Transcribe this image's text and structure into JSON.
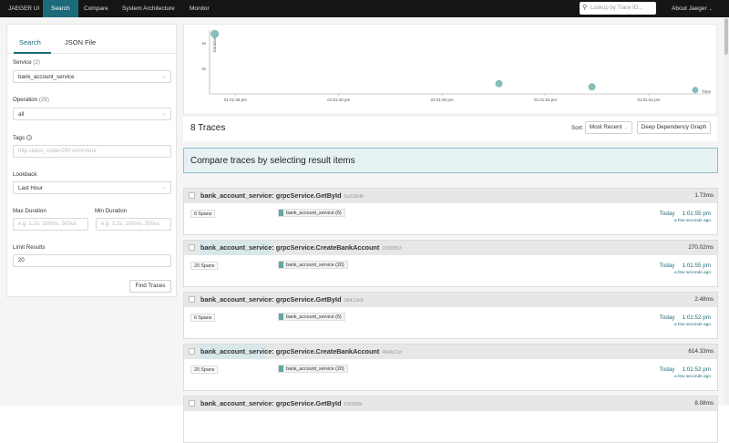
{
  "nav": {
    "brand": "JAEGER UI",
    "items": [
      "Search",
      "Compare",
      "System Architecture",
      "Monitor"
    ],
    "lookup_placeholder": "Lookup by Trace ID...",
    "about": "About Jaeger"
  },
  "sidebar": {
    "tabs": [
      "Search",
      "JSON File"
    ],
    "service_label": "Service",
    "service_count": "(2)",
    "service_value": "bank_account_service",
    "operation_label": "Operation",
    "operation_count": "(26)",
    "operation_value": "all",
    "tags_label": "Tags",
    "tags_placeholder": "http.status_code=200 error=true",
    "lookback_label": "Lookback",
    "lookback_value": "Last Hour",
    "max_duration_label": "Max Duration",
    "max_duration_placeholder": "e.g. 1.2s, 100ms, 500us",
    "min_duration_label": "Min Duration",
    "min_duration_placeholder": "e.g. 1.2s, 100ms, 500us",
    "limit_label": "Limit Results",
    "limit_value": "20",
    "find_button": "Find Traces"
  },
  "chart_data": {
    "type": "scatter",
    "ylabel": "Duration",
    "y_ticks": [
      "4s",
      "2s"
    ],
    "x_ticks": [
      "01:01:46 pm",
      "01:01:48 pm",
      "01:01:50 pm",
      "01:01:52 pm",
      "01:01:54 pm"
    ],
    "x_tail_label": "Time",
    "xlim": [
      45.5,
      55.2
    ],
    "ylim": [
      0,
      5
    ],
    "points": [
      {
        "x": 45.6,
        "y": 4.7,
        "r": 4.5
      },
      {
        "x": 51.1,
        "y": 0.8,
        "r": 4
      },
      {
        "x": 52.9,
        "y": 0.55,
        "r": 4
      },
      {
        "x": 54.9,
        "y": 0.3,
        "r": 3.5
      }
    ]
  },
  "results": {
    "count_text": "8 Traces",
    "sort_label": "Sort:",
    "sort_value": "Most Recent",
    "ddg_button": "Deep Dependency Graph",
    "compare_text": "Compare traces by selecting result items"
  },
  "traces": [
    {
      "service": "bank_account_service:",
      "op": "grpcService.GetById",
      "id": "6a338db",
      "duration": "1.73ms",
      "spans": "6 Spans",
      "svc_tag": "bank_account_service (6)",
      "day": "Today",
      "time": "1:01:55 pm",
      "ago": "a few seconds ago"
    },
    {
      "service": "bank_account_service:",
      "op": "grpcService.CreateBankAccount",
      "id": "2208853",
      "duration": "270.02ms",
      "spans": "20 Spans",
      "svc_tag": "bank_account_service (20)",
      "day": "Today",
      "time": "1:01:55 pm",
      "ago": "a few seconds ago"
    },
    {
      "service": "bank_account_service:",
      "op": "grpcService.GetById",
      "id": "06413e5",
      "duration": "2.48ms",
      "spans": "6 Spans",
      "svc_tag": "bank_account_service (6)",
      "day": "Today",
      "time": "1:01:52 pm",
      "ago": "a few seconds ago"
    },
    {
      "service": "bank_account_service:",
      "op": "grpcService.CreateBankAccount",
      "id": "494b21d",
      "duration": "614.33ms",
      "spans": "20 Spans",
      "svc_tag": "bank_account_service (20)",
      "day": "Today",
      "time": "1:01:52 pm",
      "ago": "a few seconds ago"
    },
    {
      "service": "bank_account_service:",
      "op": "grpcService.GetById",
      "id": "530f30b",
      "duration": "8.08ms",
      "spans": "",
      "svc_tag": "",
      "day": "",
      "time": "",
      "ago": ""
    }
  ]
}
